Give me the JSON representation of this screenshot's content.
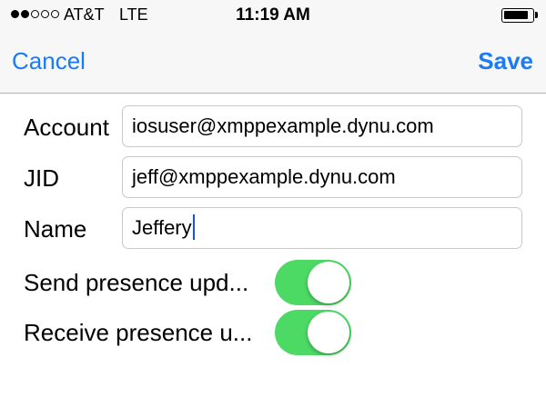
{
  "status_bar": {
    "carrier": "AT&T",
    "network": "LTE",
    "time": "11:19 AM",
    "signal_bars_filled": 2,
    "signal_bars_total": 5
  },
  "nav": {
    "cancel_label": "Cancel",
    "save_label": "Save",
    "accent_color": "#1a7cf5"
  },
  "form": {
    "account": {
      "label": "Account",
      "value": "iosuser@xmppexample.dynu.com"
    },
    "jid": {
      "label": "JID",
      "value": "jeff@xmppexample.dynu.com"
    },
    "name": {
      "label": "Name",
      "value": "Jeffery"
    },
    "send_presence": {
      "label": "Send presence upd...",
      "enabled": true
    },
    "receive_presence": {
      "label": "Receive presence u...",
      "enabled": true
    },
    "toggle_on_color": "#4cd964"
  }
}
